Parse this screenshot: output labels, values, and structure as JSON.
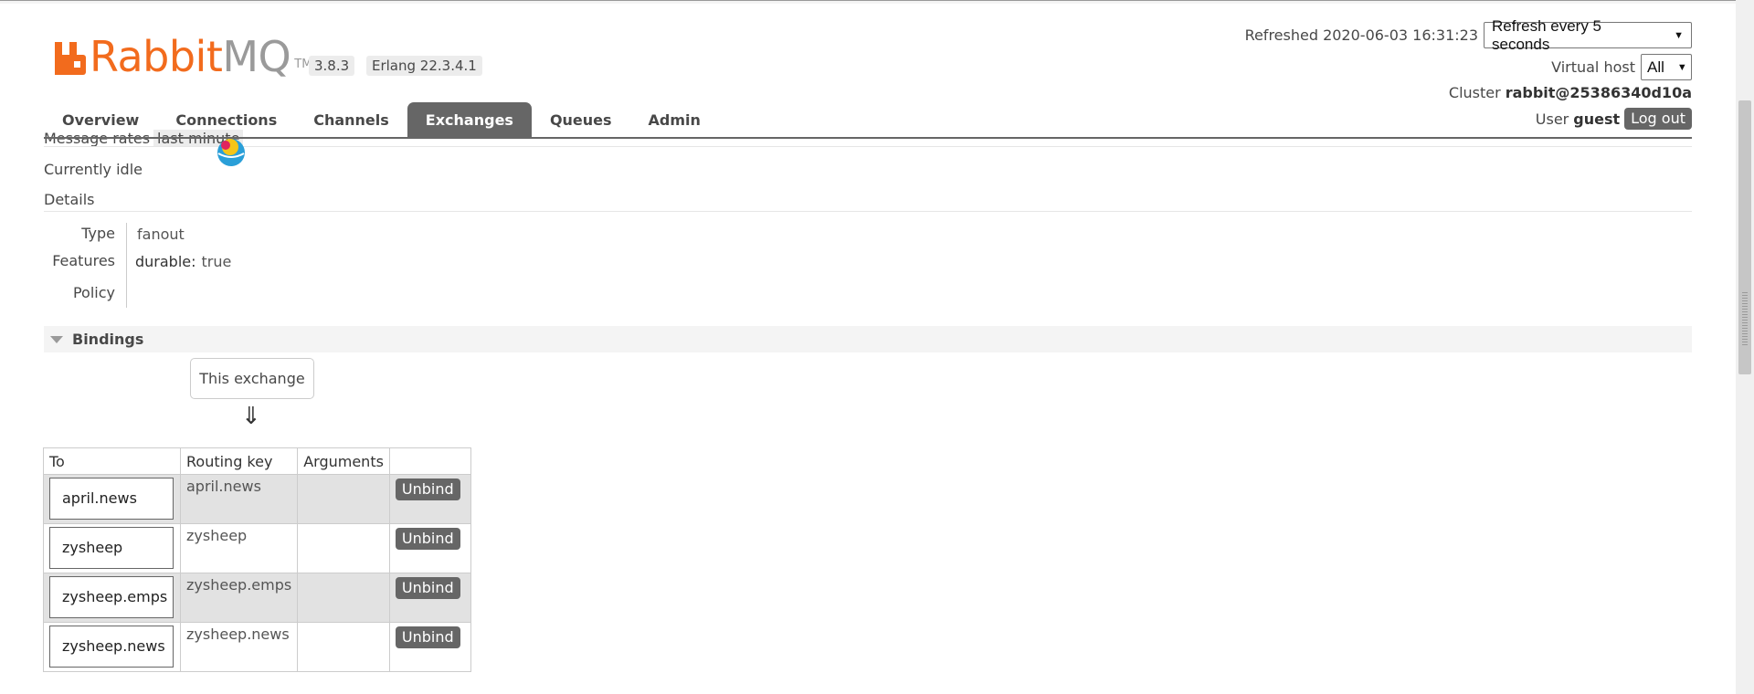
{
  "header": {
    "logo": {
      "brand_orange": "RabbitMQ",
      "rabbit": "Rabbit",
      "mq": "MQ",
      "tm": "TM"
    },
    "version": "3.8.3",
    "erlang": "Erlang 22.3.4.1",
    "refreshed_label": "Refreshed 2020-06-03 16:31:23",
    "refresh_select": "Refresh every 5 seconds",
    "vhost_label": "Virtual host",
    "vhost_select": "All",
    "cluster_label": "Cluster",
    "cluster_name": "rabbit@25386340d10a",
    "user_label": "User",
    "user_name": "guest",
    "logout": "Log out"
  },
  "nav": {
    "tabs": [
      {
        "label": "Overview"
      },
      {
        "label": "Connections"
      },
      {
        "label": "Channels"
      },
      {
        "label": "Exchanges",
        "active": true
      },
      {
        "label": "Queues"
      },
      {
        "label": "Admin"
      }
    ]
  },
  "overview": {
    "message_rates_label": "Message rates",
    "message_rates_period": "last minute",
    "status": "Currently idle"
  },
  "details": {
    "title": "Details",
    "type_label": "Type",
    "type_value": "fanout",
    "features_label": "Features",
    "feature_key": "durable:",
    "feature_value": "true",
    "policy_label": "Policy"
  },
  "bindings": {
    "title": "Bindings",
    "source_box": "This exchange",
    "arrow": "⇓",
    "columns": {
      "to": "To",
      "routing_key": "Routing key",
      "arguments": "Arguments",
      "actions": ""
    },
    "rows": [
      {
        "to": "april.news",
        "routing_key": "april.news",
        "arguments": "",
        "action": "Unbind"
      },
      {
        "to": "zysheep",
        "routing_key": "zysheep",
        "arguments": "",
        "action": "Unbind"
      },
      {
        "to": "zysheep.emps",
        "routing_key": "zysheep.emps",
        "arguments": "",
        "action": "Unbind"
      },
      {
        "to": "zysheep.news",
        "routing_key": "zysheep.news",
        "arguments": "",
        "action": "Unbind"
      }
    ]
  },
  "colors": {
    "brand": "#f26b1d",
    "nav_active": "#666666",
    "button": "#666666"
  },
  "icons": {
    "lightbulb": "lightbulb-icon",
    "collapse": "triangle-down-icon"
  }
}
